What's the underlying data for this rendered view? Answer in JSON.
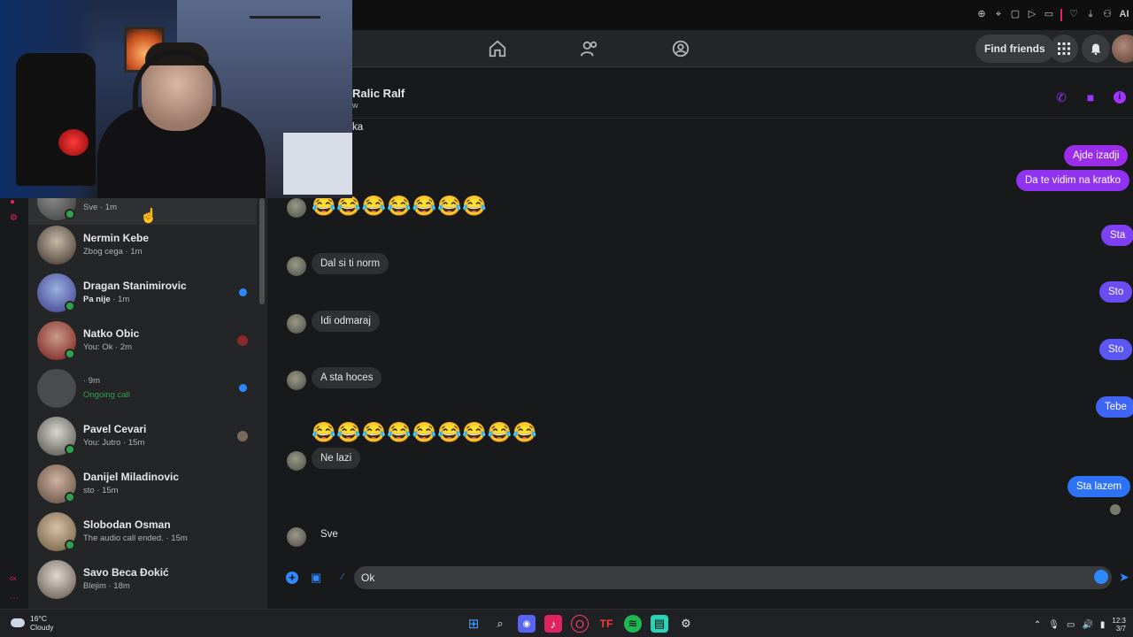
{
  "browser": {
    "toolbar_icons": [
      "zoom-icon",
      "pin-icon",
      "tab-icon",
      "play-icon",
      "heart-icon",
      "download-icon",
      "profile-icon",
      "ai-icon"
    ],
    "ai_label": "AI"
  },
  "header": {
    "find_friends": "Find friends",
    "nav": [
      "home-icon",
      "friends-icon",
      "groups-icon"
    ]
  },
  "chat_list": {
    "items": [
      {
        "name": "",
        "preview": "Sve · 1m",
        "status": "read"
      },
      {
        "name": "Nermin Kebe",
        "preview": "Zbog cega · 1m",
        "status": "read"
      },
      {
        "name": "Dragan Stanimirovic",
        "preview_bold": "Pa nije",
        "preview_time": " · 1m",
        "status": "unread"
      },
      {
        "name": "Natko Obic",
        "preview": "You: Ok · 2m",
        "status": "seen"
      },
      {
        "name": "",
        "preview": "· 9m",
        "call": "Ongoing call",
        "status": "unread"
      },
      {
        "name": "Pavel Cevari",
        "preview": "You: Jutro · 15m",
        "status": "seen"
      },
      {
        "name": "Danijel Miladinovic",
        "preview": "sto · 15m",
        "status": "read"
      },
      {
        "name": "Slobodan Osman",
        "preview": "The audio call ended. · 15m",
        "status": "read"
      },
      {
        "name": "Savo Beca Đokić",
        "preview": "Blejim · 18m",
        "status": "read"
      }
    ]
  },
  "conversation": {
    "title": "Ralic Ralf",
    "status": "w",
    "partial_top": "ka",
    "messages": [
      {
        "dir": "out",
        "text": "Ajde izadji"
      },
      {
        "dir": "out",
        "text": "Da te vidim na kratko"
      },
      {
        "dir": "in",
        "text": "😂😂😂😂😂😂😂"
      },
      {
        "dir": "out",
        "text": "Sta"
      },
      {
        "dir": "in",
        "text": "Dal si ti norm"
      },
      {
        "dir": "out",
        "text": "Sto"
      },
      {
        "dir": "in",
        "text": "Idi odmaraj"
      },
      {
        "dir": "out",
        "text": "Sto"
      },
      {
        "dir": "in",
        "text": "A sta hoces"
      },
      {
        "dir": "out",
        "text": "Tebe"
      },
      {
        "dir": "in",
        "text": "😂😂😂😂😂😂😂😂😂"
      },
      {
        "dir": "in",
        "text": "Ne lazi"
      },
      {
        "dir": "out",
        "text": "Sta lazem"
      },
      {
        "dir": "in",
        "text": "Sve"
      }
    ],
    "composer_value": "Ok"
  },
  "taskbar": {
    "temp": "16°C",
    "weather": "Cloudy",
    "time": "12:3",
    "date": "3/7"
  },
  "colors": {
    "accent_blue": "#2e89ff",
    "accent_purple": "#a033ff",
    "online": "#31a24c"
  }
}
